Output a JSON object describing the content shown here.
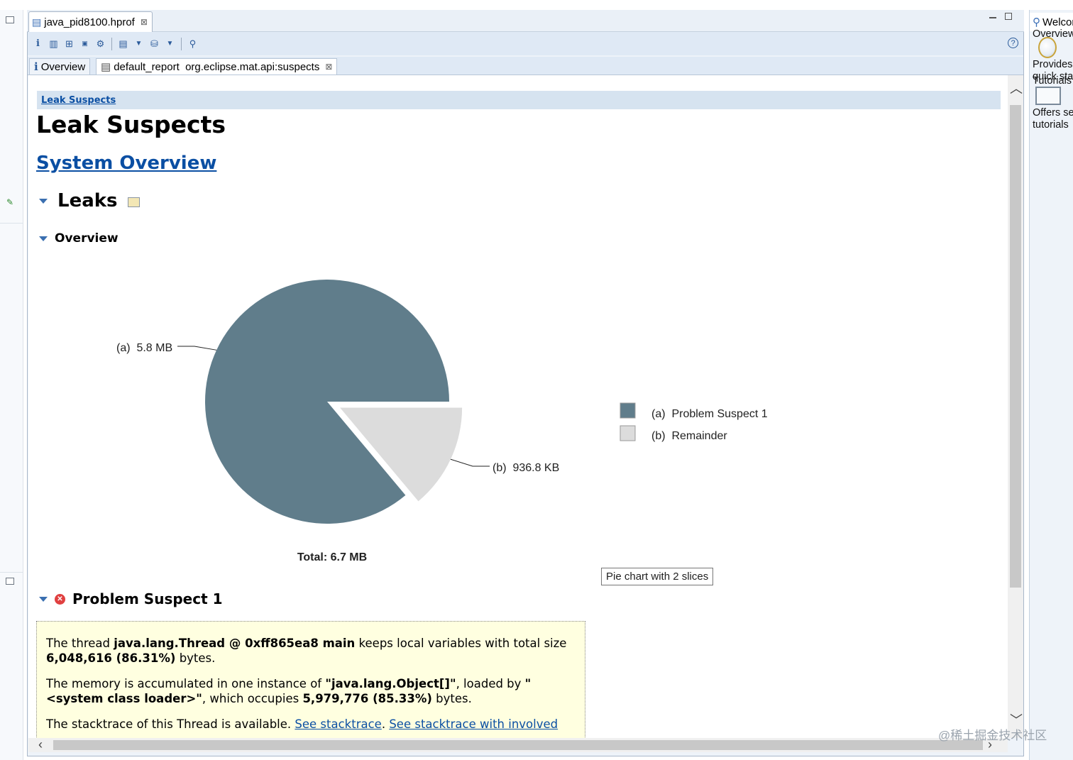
{
  "editor": {
    "tab_title": "java_pid8100.hprof",
    "subtabs": [
      {
        "label": "Overview"
      },
      {
        "label": "default_report  org.eclipse.mat.api:suspects"
      }
    ]
  },
  "report": {
    "breadcrumb": "Leak Suspects",
    "title": "Leak Suspects",
    "system_overview_link": "System Overview",
    "leaks_heading": "Leaks",
    "overview_heading": "Overview",
    "tooltip": "Pie chart with 2 slices",
    "problem_suspect_heading": "Problem Suspect 1",
    "suspect": {
      "p1_pre": "The thread ",
      "p1_bold1": "java.lang.Thread @ 0xff865ea8 main",
      "p1_mid": " keeps local variables with total size ",
      "p1_bold2": "6,048,616 (86.31%)",
      "p1_post": " bytes.",
      "p2_pre": "The memory is accumulated in one instance of ",
      "p2_bold1": "\"java.lang.Object[]\"",
      "p2_mid1": ", loaded by ",
      "p2_bold2": "\"<system class loader>\"",
      "p2_mid2": ", which occupies ",
      "p2_bold3": "5,979,776 (85.33%)",
      "p2_post": " bytes.",
      "p3_pre": "The stacktrace of this Thread is available. ",
      "p3_link1": "See stacktrace",
      "p3_sep": ". ",
      "p3_link2": "See stacktrace with involved"
    }
  },
  "chart_data": {
    "type": "pie",
    "total_label": "Total: 6.7 MB",
    "slices": [
      {
        "label": "(a)  5.8 MB",
        "legend": "(a)  Problem Suspect 1",
        "value": 5.8,
        "color": "#607d8b"
      },
      {
        "label": "(b)  936.8 KB",
        "legend": "(b)  Remainder",
        "value": 0.9368,
        "color": "#dcdcdc"
      }
    ]
  },
  "right_panel": {
    "tab_title": "Welcome",
    "line1": "Overview",
    "line2": "Provides",
    "line3": "quick sta",
    "line4": "Tutorials",
    "line5": "Offers se",
    "line6": "tutorials"
  },
  "watermark": "@稀土掘金技术社区",
  "colors": {
    "accent": "#0b4fa3",
    "suspect_box_bg": "#ffffe0",
    "breadcrumb_bg": "#d6e3f0"
  }
}
